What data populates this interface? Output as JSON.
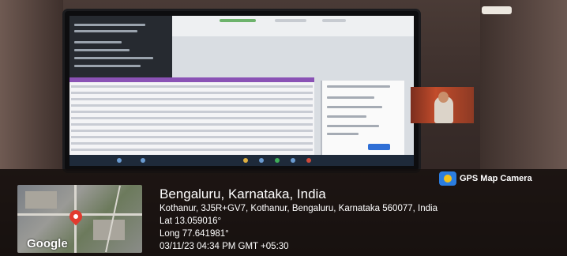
{
  "badge": {
    "label": "GPS Map Camera",
    "icon": "gps-map-camera-icon",
    "accent": "#2b7de0"
  },
  "map": {
    "brand": "Google",
    "pin_color": "#e23a2e"
  },
  "location": {
    "city": "Bengaluru, Karnataka, India",
    "address": "Kothanur, 3J5R+GV7, Kothanur, Bengaluru, Karnataka 560077, India",
    "latitude": "Lat 13.059016°",
    "longitude": "Long 77.641981°",
    "datetime": "03/11/23 04:34 PM GMT +05:30"
  }
}
